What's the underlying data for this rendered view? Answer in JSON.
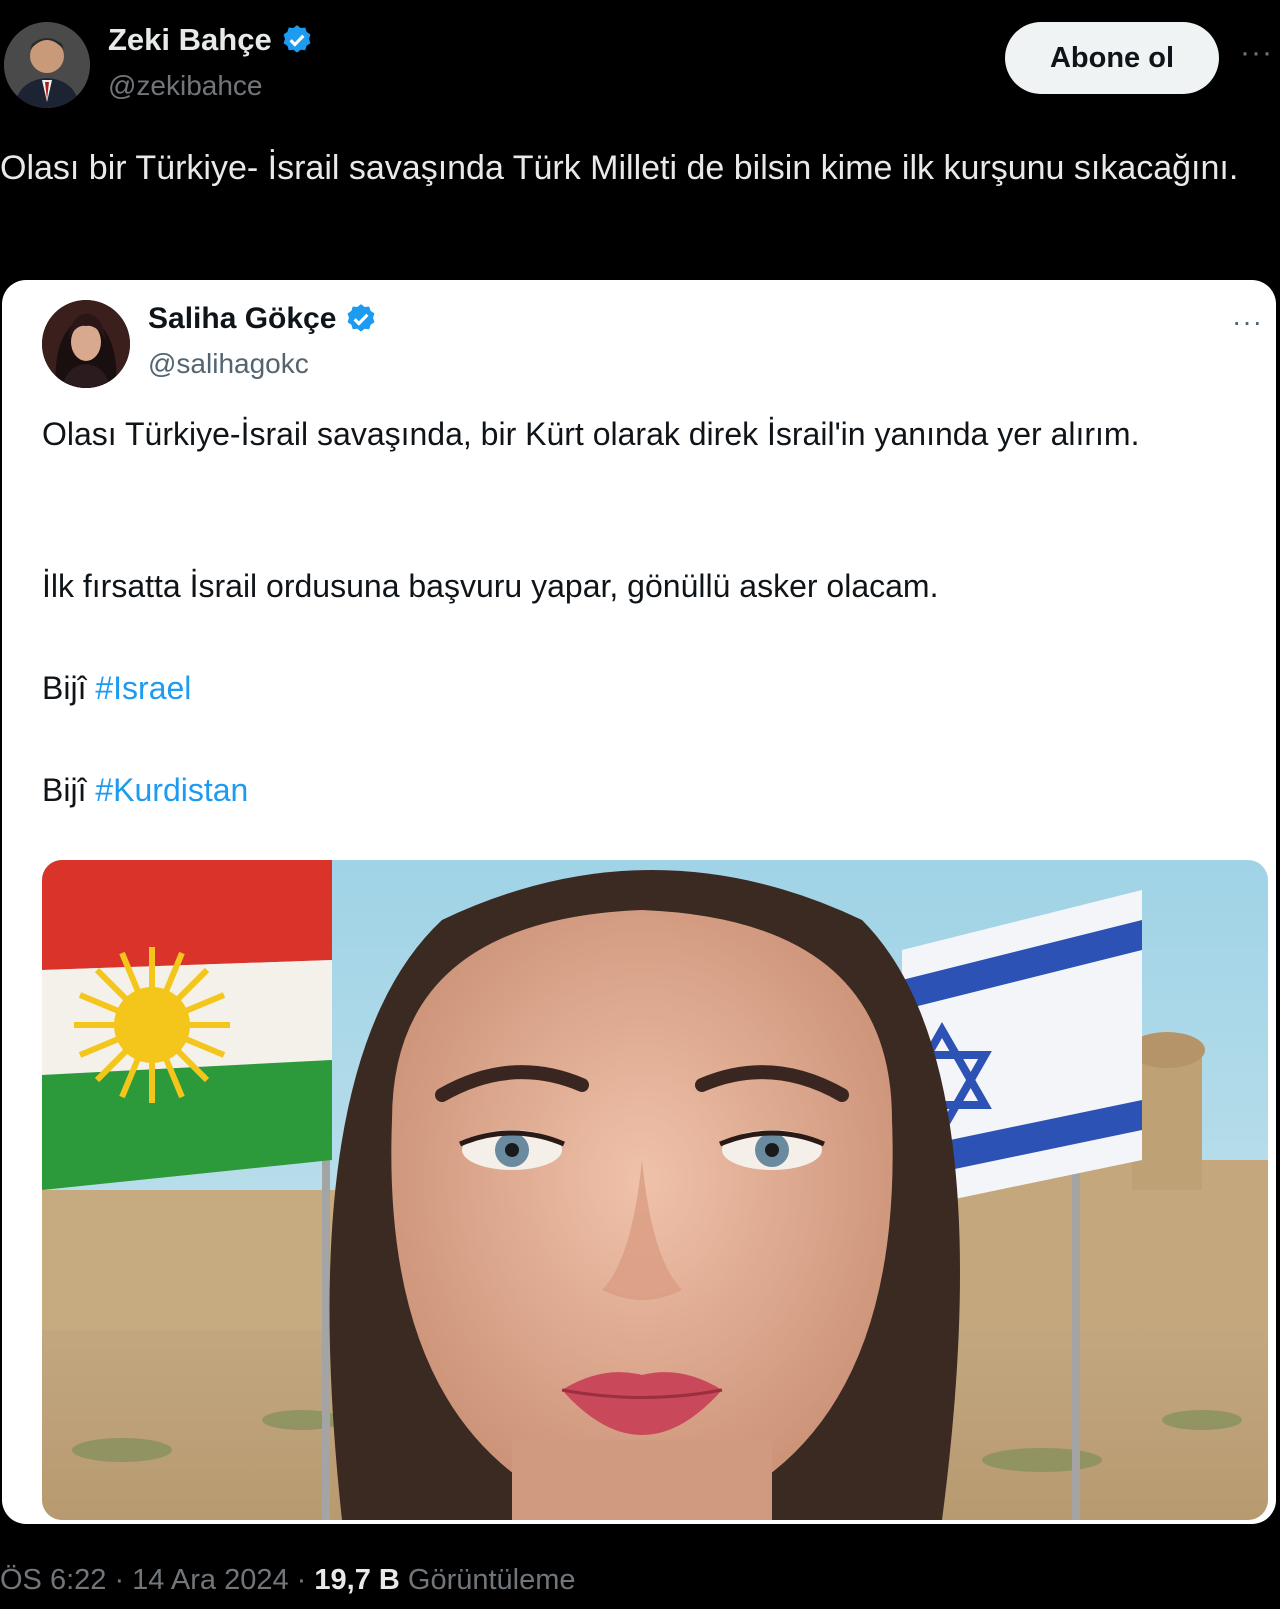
{
  "tweet": {
    "author": {
      "name": "Zeki Bahçe",
      "handle": "@zekibahce",
      "verified": true
    },
    "follow_label": "Abone ol",
    "more_icon": "more-dots-icon",
    "text": "Olası bir Türkiye- İsrail savaşında Türk Milleti de bilsin kime ilk kurşunu sıkacağını.",
    "timestamp": "ÖS 6:22 · 14 Ara 2024 ·",
    "views_count": "19,7 B",
    "views_label": "Görüntüleme"
  },
  "quoted": {
    "author": {
      "name": "Saliha Gökçe",
      "handle": "@salihagokc",
      "verified": true
    },
    "paragraph1": "Olası  Türkiye-İsrail savaşında, bir Kürt olarak direk İsrail'in yanında yer alırım.",
    "paragraph2": "İlk fırsatta İsrail ordusuna başvuru yapar, gönüllü asker olacam.",
    "line3_prefix": "Bijî ",
    "line3_tag": "#Israel",
    "line4_prefix": "Bijî ",
    "line4_tag": "#Kurdistan"
  },
  "colors": {
    "accent": "#1d9bf0",
    "background": "#000000",
    "card": "#ffffff"
  }
}
